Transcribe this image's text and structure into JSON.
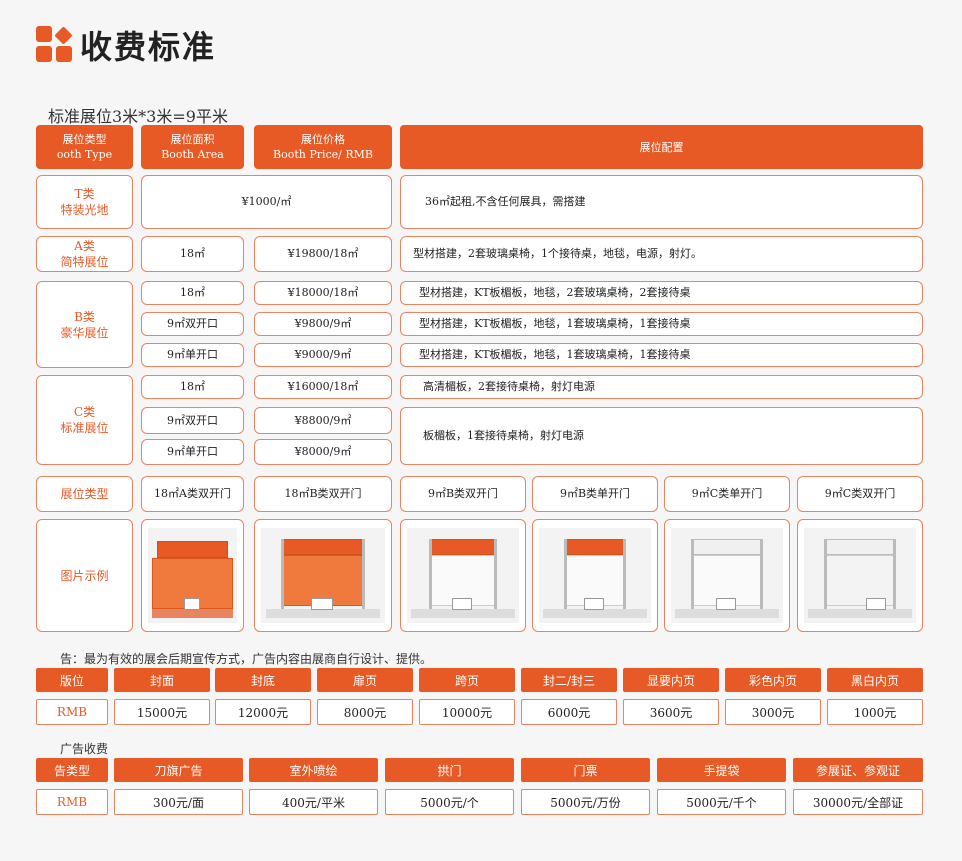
{
  "page": {
    "title": "收费标准",
    "subtitle": "标准展位3米*3米=9平米"
  },
  "booth_header": {
    "type": [
      "展位类型",
      "ooth Type"
    ],
    "area": [
      "展位面积",
      "Booth Area"
    ],
    "price": [
      "展位价格",
      "Booth Price/ RMB"
    ],
    "config": "展位配置"
  },
  "booth_t": {
    "label": [
      "T类",
      "特装光地"
    ],
    "price": "¥1000/㎡",
    "config": "36㎡起租,不含任何展具，需搭建"
  },
  "booth_a": {
    "label": [
      "A类",
      "简特展位"
    ],
    "area": "18㎡",
    "price": "¥19800/18㎡",
    "config": "型材搭建，2套玻璃桌椅，1个接待桌，地毯，电源，射灯。"
  },
  "booth_b": {
    "label": [
      "B类",
      "豪华展位"
    ],
    "rows": [
      {
        "area": "18㎡",
        "price": "¥18000/18㎡",
        "config": "型材搭建，KT板楣板，地毯，2套玻璃桌椅，2套接待桌"
      },
      {
        "area": "9㎡双开口",
        "price": "¥9800/9㎡",
        "config": "型材搭建，KT板楣板，地毯，1套玻璃桌椅，1套接待桌"
      },
      {
        "area": "9㎡单开口",
        "price": "¥9000/9㎡",
        "config": "型材搭建，KT板楣板，地毯，1套玻璃桌椅，1套接待桌"
      }
    ]
  },
  "booth_c": {
    "label": [
      "C类",
      "标准展位"
    ],
    "rows": [
      {
        "area": "18㎡",
        "price": "¥16000/18㎡"
      },
      {
        "area": "9㎡双开口",
        "price": "¥8800/9㎡"
      },
      {
        "area": "9㎡单开口",
        "price": "¥8000/9㎡"
      }
    ],
    "config_1": "高清楣板，2套接待桌椅，射灯电源",
    "config_2": "板楣板，1套接待桌椅，射灯电源"
  },
  "booth_types": {
    "label": "展位类型",
    "items": [
      "18㎡A类双开门",
      "18㎡B类双开门",
      "9㎡B类双开门",
      "9㎡B类单开门",
      "9㎡C类单开门",
      "9㎡C类双开门"
    ]
  },
  "examples": {
    "label": "图片示例",
    "banner_text": "淄博中国国际会展中心"
  },
  "ad_note": "告：最为有效的展会后期宣传方式，广告内容由展商自行设计、提供。",
  "ad_table_1": {
    "headers": [
      "版位",
      "封面",
      "封底",
      "扉页",
      "跨页",
      "封二/封三",
      "显要内页",
      "彩色内页",
      "黑白内页"
    ],
    "values": [
      "RMB",
      "15000元",
      "12000元",
      "8000元",
      "10000元",
      "6000元",
      "3600元",
      "3000元",
      "1000元"
    ]
  },
  "ad_fee_title": "广告收费",
  "ad_table_2": {
    "headers": [
      "告类型",
      "刀旗广告",
      "室外喷绘",
      "拱门",
      "门票",
      "手提袋",
      "参展证、参观证"
    ],
    "values": [
      "RMB",
      "300元/面",
      "400元/平米",
      "5000元/个",
      "5000元/万份",
      "5000元/千个",
      "30000元/全部证"
    ]
  },
  "colors": {
    "accent": "#e85a25",
    "border": "#e8845f",
    "background": "#f6f6f6"
  }
}
